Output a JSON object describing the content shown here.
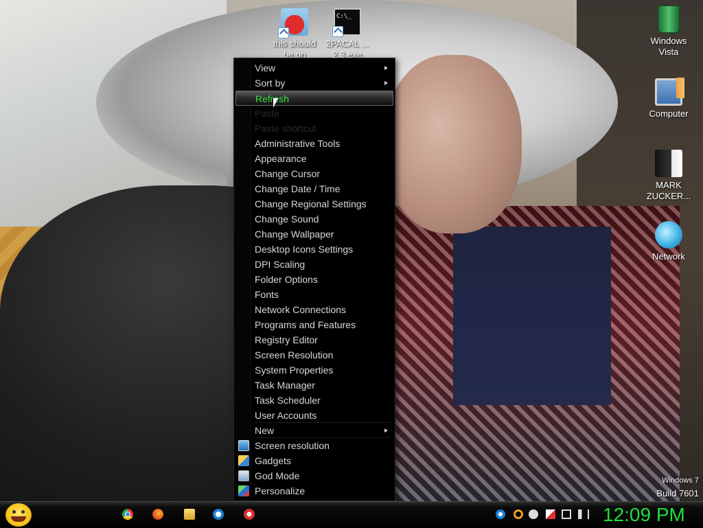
{
  "desktop": {
    "icons": [
      {
        "label": "this should be on",
        "icon": "angry-birds-icon"
      },
      {
        "label": "2PACAL ... 2.3.exe",
        "icon": "command-prompt-icon"
      },
      {
        "label": "Windows Vista",
        "icon": "recycle-bin-icon"
      },
      {
        "label": "Computer",
        "icon": "computer-icon"
      },
      {
        "label": "MARK ZUCKER...",
        "icon": "user-portrait-icon"
      },
      {
        "label": "Network",
        "icon": "network-icon"
      }
    ],
    "cmd_icon_text": "C:\\_"
  },
  "context_menu": {
    "items": [
      {
        "label": "View",
        "submenu": true
      },
      {
        "label": "Sort by",
        "submenu": true
      },
      {
        "label": "Refresh",
        "state": "hover"
      },
      {
        "label": "Paste",
        "state": "disabled"
      },
      {
        "label": "Paste shortcut",
        "state": "disabled"
      },
      {
        "label": "Administrative Tools"
      },
      {
        "label": "Appearance"
      },
      {
        "label": "Change Cursor"
      },
      {
        "label": "Change Date / Time"
      },
      {
        "label": "Change Regional Settings"
      },
      {
        "label": "Change Sound"
      },
      {
        "label": "Change Wallpaper"
      },
      {
        "label": "Desktop Icons Settings"
      },
      {
        "label": "DPI Scaling"
      },
      {
        "label": "Folder Options"
      },
      {
        "label": "Fonts"
      },
      {
        "label": "Network Connections"
      },
      {
        "label": "Programs and Features"
      },
      {
        "label": "Registry Editor"
      },
      {
        "label": "Screen Resolution"
      },
      {
        "label": "System Properties"
      },
      {
        "label": "Task Manager"
      },
      {
        "label": "Task Scheduler"
      },
      {
        "label": "User Accounts"
      },
      {
        "label": "New",
        "submenu": true
      },
      {
        "label": "Screen resolution",
        "icon": "screen-resolution-icon"
      },
      {
        "label": "Gadgets",
        "icon": "gadgets-icon"
      },
      {
        "label": "God Mode",
        "icon": "god-mode-icon"
      },
      {
        "label": "Personalize",
        "icon": "personalize-icon"
      }
    ],
    "colors": {
      "background": "#000000",
      "text": "#d8d8d8",
      "hover_text": "#36e03a"
    }
  },
  "watermark": {
    "line1": "Windows 7",
    "line2": "Build 7601"
  },
  "taskbar": {
    "start_icon": "smiley-start-icon",
    "pinned": [
      "chrome-icon",
      "firefox-icon",
      "file-explorer-icon",
      "teamviewer-icon",
      "opera-icon"
    ],
    "tray": [
      "teamviewer-tray-icon",
      "search-tray-icon",
      "messenger-tray-icon",
      "action-center-flag-icon",
      "network-tray-icon",
      "volume-icon"
    ],
    "clock": "12:09 PM",
    "clock_color": "#1ee03a"
  }
}
